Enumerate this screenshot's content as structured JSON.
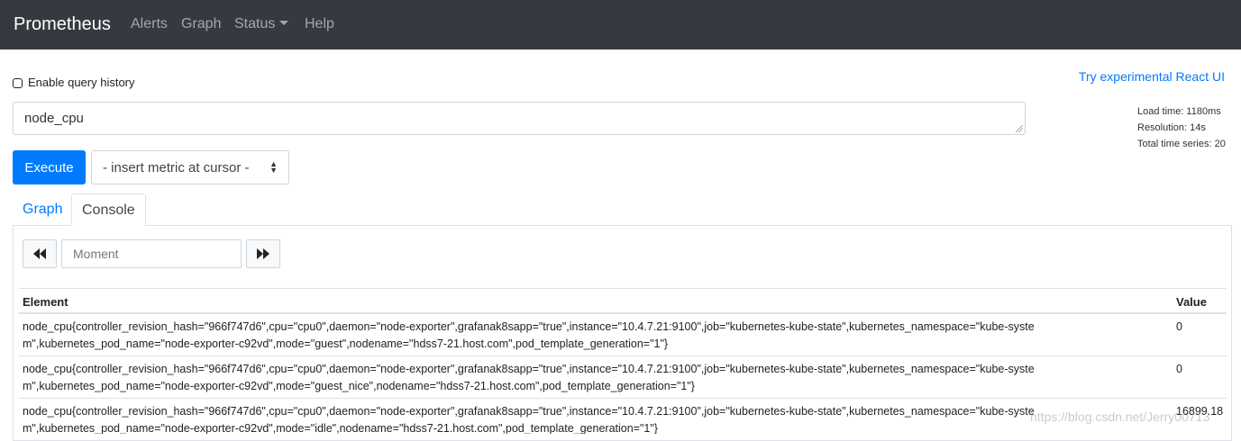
{
  "navbar": {
    "brand": "Prometheus",
    "links": [
      "Alerts",
      "Graph",
      "Status",
      "Help"
    ]
  },
  "query": {
    "history_label": "Enable query history",
    "react_link": "Try experimental React UI",
    "expression": "node_cpu",
    "stats": {
      "load_time": "Load time: 1180ms",
      "resolution": "Resolution: 14s",
      "total_series": "Total time series: 20"
    },
    "execute_label": "Execute",
    "metric_select": "- insert metric at cursor -"
  },
  "tabs": [
    "Graph",
    "Console"
  ],
  "console": {
    "moment_placeholder": "Moment",
    "headers": {
      "element": "Element",
      "value": "Value"
    },
    "rows": [
      {
        "element": "node_cpu{controller_revision_hash=\"966f747d6\",cpu=\"cpu0\",daemon=\"node-exporter\",grafanak8sapp=\"true\",instance=\"10.4.7.21:9100\",job=\"kubernetes-kube-state\",kubernetes_namespace=\"kube-system\",kubernetes_pod_name=\"node-exporter-c92vd\",mode=\"guest\",nodename=\"hdss7-21.host.com\",pod_template_generation=\"1\"}",
        "value": "0"
      },
      {
        "element": "node_cpu{controller_revision_hash=\"966f747d6\",cpu=\"cpu0\",daemon=\"node-exporter\",grafanak8sapp=\"true\",instance=\"10.4.7.21:9100\",job=\"kubernetes-kube-state\",kubernetes_namespace=\"kube-system\",kubernetes_pod_name=\"node-exporter-c92vd\",mode=\"guest_nice\",nodename=\"hdss7-21.host.com\",pod_template_generation=\"1\"}",
        "value": "0"
      },
      {
        "element": "node_cpu{controller_revision_hash=\"966f747d6\",cpu=\"cpu0\",daemon=\"node-exporter\",grafanak8sapp=\"true\",instance=\"10.4.7.21:9100\",job=\"kubernetes-kube-state\",kubernetes_namespace=\"kube-system\",kubernetes_pod_name=\"node-exporter-c92vd\",mode=\"idle\",nodename=\"hdss7-21.host.com\",pod_template_generation=\"1\"}",
        "value": "16899.18"
      }
    ]
  },
  "watermark": "https://blog.csdn.net/Jerry00713"
}
